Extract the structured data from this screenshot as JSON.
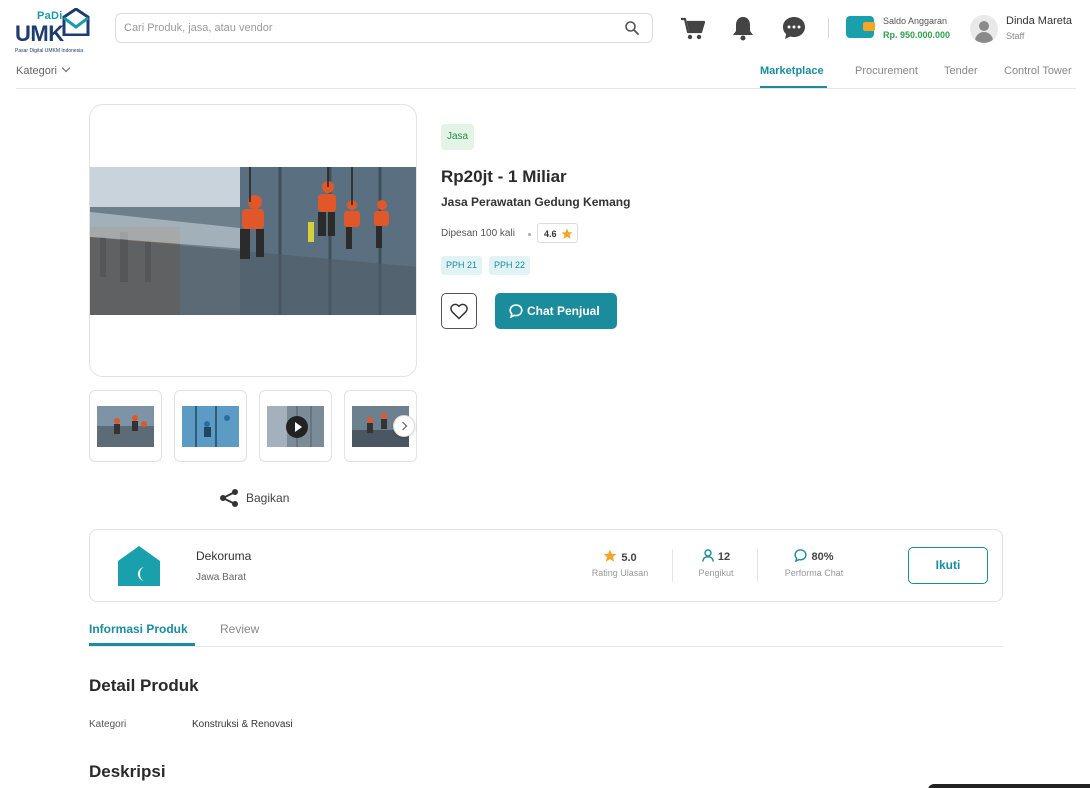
{
  "header": {
    "logo": {
      "brand": "PaDi",
      "name": "UMK",
      "tagline": "Pasar Digital UMKM Indonesia"
    },
    "search_placeholder": "Cari Produk, jasa, atau vendor",
    "icons": [
      "cart-icon",
      "bell-icon",
      "chat-icon"
    ],
    "saldo_label": "Saldo Anggaran",
    "saldo_value": "Rp. 950.000.000",
    "user_name": "Dinda Mareta",
    "user_role": "Staff"
  },
  "nav": {
    "kategori": "Kategori",
    "tabs": [
      {
        "label": "Marketplace",
        "active": true
      },
      {
        "label": "Procurement",
        "active": false
      },
      {
        "label": "Tender",
        "active": false
      },
      {
        "label": "Control Tower",
        "active": false
      }
    ]
  },
  "product": {
    "type_badge": "Jasa",
    "price": "Rp20jt - 1 Miliar",
    "name": "Jasa Perawatan Gedung Kemang",
    "ordered": "Dipesan 100 kali",
    "rating": "4.6",
    "taxes": [
      "PPH 21",
      "PPH 22"
    ],
    "chat_label": "Chat Penjual",
    "share_label": "Bagikan"
  },
  "seller": {
    "name": "Dekoruma",
    "location": "Jawa Barat",
    "stats": [
      {
        "value": "5.0",
        "label": "Rating Ulasan"
      },
      {
        "value": "12",
        "label": "Pengikut"
      },
      {
        "value": "80%",
        "label": "Performa Chat"
      }
    ],
    "follow_label": "Ikuti"
  },
  "tabs": [
    {
      "label": "Informasi Produk",
      "active": true
    },
    {
      "label": "Review",
      "active": false
    }
  ],
  "detail": {
    "title": "Detail Produk",
    "kategori_label": "Kategori",
    "kategori_value": "Konstruksi & Renovasi",
    "desc_title": "Deskripsi"
  },
  "colors": {
    "primary": "#1a8c9c",
    "green": "#2e9f4a",
    "star": "#f3a623"
  }
}
